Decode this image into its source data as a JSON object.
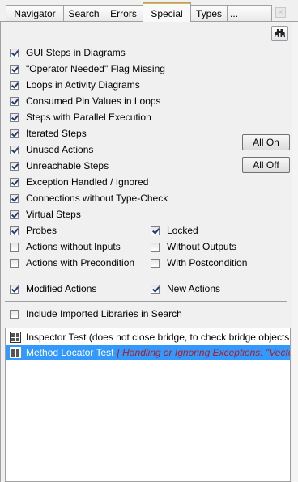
{
  "tabs": [
    {
      "label": "Navigator",
      "active": false
    },
    {
      "label": "Search",
      "active": false
    },
    {
      "label": "Errors",
      "active": false
    },
    {
      "label": "Special",
      "active": true
    },
    {
      "label": "Types",
      "active": false
    },
    {
      "label": "...",
      "active": false
    }
  ],
  "close_symbol": "×",
  "checks": [
    {
      "label": "GUI Steps in Diagrams",
      "checked": true
    },
    {
      "label": "\"Operator Needed\" Flag Missing",
      "checked": true
    },
    {
      "label": "Loops in Activity Diagrams",
      "checked": true
    },
    {
      "label": "Consumed Pin Values in Loops",
      "checked": true
    },
    {
      "label": "Steps with Parallel Execution",
      "checked": true
    },
    {
      "label": "Iterated Steps",
      "checked": true
    },
    {
      "label": "Unused Actions",
      "checked": true
    },
    {
      "label": "Unreachable Steps",
      "checked": true
    },
    {
      "label": "Exception Handled / Ignored",
      "checked": true
    },
    {
      "label": "Connections without Type-Check",
      "checked": true
    },
    {
      "label": "Virtual Steps",
      "checked": true
    }
  ],
  "pairs": [
    {
      "left": {
        "label": "Probes",
        "checked": true
      },
      "right": {
        "label": "Locked",
        "checked": true
      }
    },
    {
      "left": {
        "label": "Actions without Inputs",
        "checked": false
      },
      "right": {
        "label": "Without Outputs",
        "checked": false
      }
    },
    {
      "left": {
        "label": "Actions with Precondition",
        "checked": false
      },
      "right": {
        "label": "With Postcondition",
        "checked": false
      }
    }
  ],
  "modified": {
    "left": {
      "label": "Modified Actions",
      "checked": true
    },
    "right": {
      "label": "New Actions",
      "checked": true
    }
  },
  "include_imported": {
    "label": "Include Imported Libraries in Search",
    "checked": false
  },
  "buttons": {
    "all_on": "All On",
    "all_off": "All Off"
  },
  "results": [
    {
      "name": "Inspector Test (does not close bridge, to check bridge objects",
      "detail": "",
      "selected": false
    },
    {
      "name": "Method Locator Test",
      "detail": "[ Handling or Ignoring Exceptions: \"Vecto",
      "selected": true
    }
  ],
  "icons": {
    "find": "binoculars-icon",
    "result": "test-case-icon"
  }
}
